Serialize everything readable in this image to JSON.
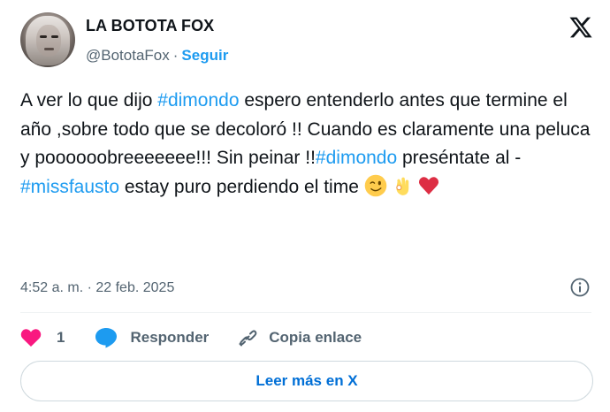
{
  "author": {
    "name": "LA BOTOTA FOX",
    "handle": "@BototaFox",
    "separator": "·",
    "follow_label": "Seguir"
  },
  "tweet": {
    "segments": [
      {
        "text": "A ver lo que dijo ",
        "type": "text"
      },
      {
        "text": "#dimondo",
        "type": "hashtag"
      },
      {
        "text": " espero entenderlo antes que termine el año ,sobre todo que se decoloró !! Cuando es claramente una peluca y poooooobreeeeeee!!! Sin peinar !!",
        "type": "text"
      },
      {
        "text": "#dimondo",
        "type": "hashtag"
      },
      {
        "text": " preséntate al -",
        "type": "text"
      },
      {
        "text": "#missfausto",
        "type": "hashtag"
      },
      {
        "text": " estay puro perdiendo el time ",
        "type": "text"
      }
    ],
    "emojis": [
      "winking-face-emoji",
      "ok-hand-emoji",
      "red-heart-emoji"
    ]
  },
  "timestamp": "4:52 a. m. · 22 feb. 2025",
  "actions": {
    "like_count": "1",
    "reply_label": "Responder",
    "copy_label": "Copia enlace"
  },
  "read_more_label": "Leer más en X",
  "colors": {
    "accent": "#1d9bf0",
    "like": "#f91880",
    "muted": "#536471",
    "text": "#0f1419"
  }
}
